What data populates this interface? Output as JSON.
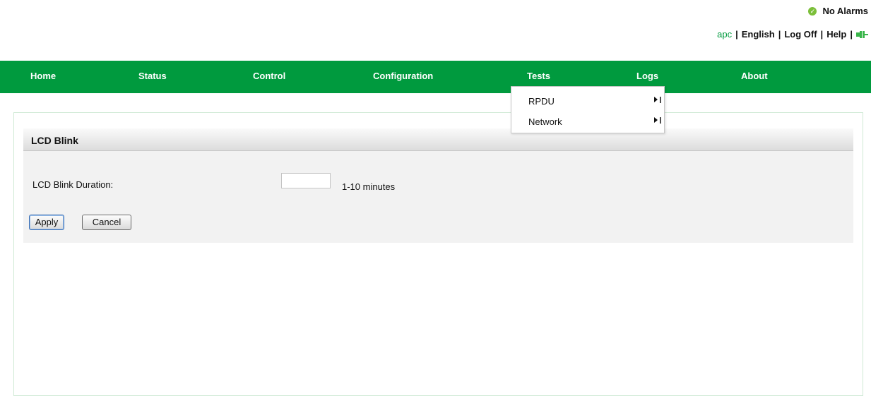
{
  "status": {
    "alarm_text": "No Alarms",
    "icon": "check-circle-icon",
    "icon_color": "#7cbf3a"
  },
  "top_links": {
    "user": "apc",
    "language": "English",
    "log_off": "Log Off",
    "help": "Help",
    "separator": "|",
    "icon": "plug-icon"
  },
  "nav": {
    "background": "#009a3e",
    "items": [
      "Home",
      "Status",
      "Control",
      "Configuration",
      "Tests",
      "Logs",
      "About"
    ]
  },
  "dropdown": {
    "items": [
      "RPDU",
      "Network"
    ]
  },
  "section": {
    "title": "LCD Blink",
    "field_label": "LCD Blink Duration:",
    "field_value": "",
    "field_hint": "1-10 minutes",
    "apply_label": "Apply",
    "cancel_label": "Cancel"
  }
}
